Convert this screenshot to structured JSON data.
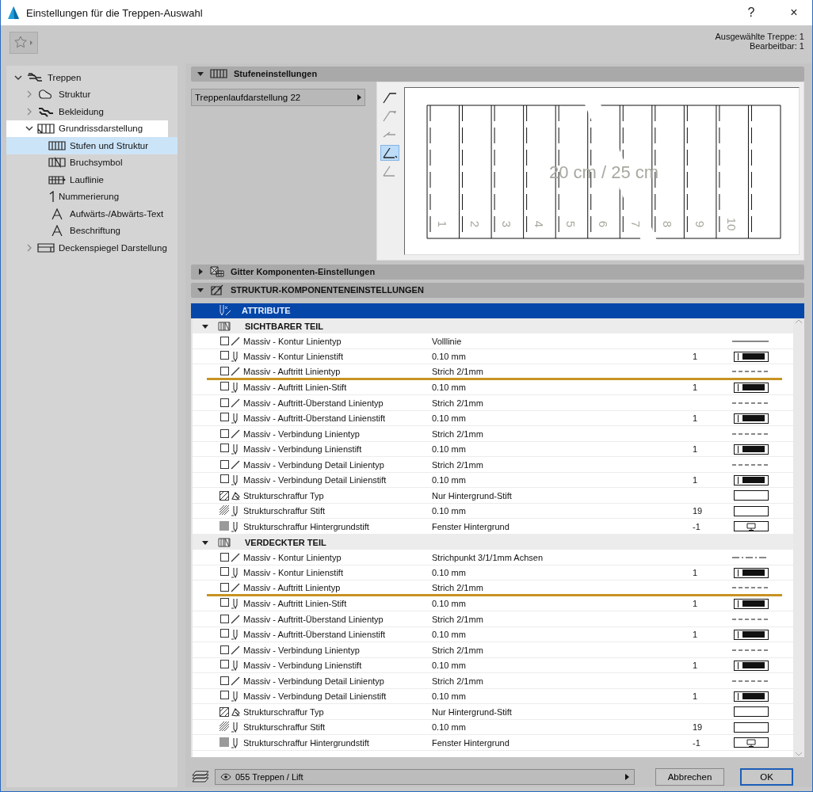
{
  "window": {
    "title": "Einstellungen für die Treppen-Auswahl",
    "help": "?",
    "close": "×"
  },
  "info": [
    "Ausgewählte Treppe: 1",
    "Bearbeitbar: 1"
  ],
  "tree": [
    {
      "label": "Treppen",
      "expanded": true,
      "selected": false,
      "highlighted": false,
      "children": [
        {
          "label": "Struktur",
          "expanded": false,
          "selected": false,
          "highlighted": false
        },
        {
          "label": "Bekleidung",
          "expanded": false,
          "selected": false,
          "highlighted": false
        },
        {
          "label": "Grundrissdarstellung",
          "expanded": true,
          "selected": false,
          "highlighted": true,
          "children": [
            {
              "label": "Stufen und Struktur",
              "selected": true,
              "highlighted": true
            },
            {
              "label": "Bruchsymbol",
              "selected": false,
              "highlighted": false
            },
            {
              "label": "Lauflinie",
              "selected": false,
              "highlighted": false
            },
            {
              "label": "Nummerierung",
              "selected": false,
              "highlighted": false
            },
            {
              "label": "Aufwärts-/Abwärts-Text",
              "selected": false,
              "highlighted": false
            },
            {
              "label": "Beschriftung",
              "selected": false,
              "highlighted": false
            }
          ]
        },
        {
          "label": "Deckenspiegel Darstellung",
          "expanded": false,
          "selected": false,
          "highlighted": false
        }
      ]
    }
  ],
  "step_settings": {
    "title": "Stufeneinstellungen",
    "expanded": true,
    "dropdown": "Treppenlaufdarstellung 22",
    "tools": [
      {
        "selected": false
      },
      {
        "selected": false
      },
      {
        "selected": false
      },
      {
        "selected": true
      },
      {
        "selected": false
      }
    ],
    "preview": {
      "dimension_label": "20 cm / 25 cm",
      "step_numbers": [
        "1",
        "2",
        "3",
        "4",
        "5",
        "6",
        "7",
        "8",
        "9",
        "10"
      ]
    }
  },
  "grid_settings": {
    "title": "Gitter Komponenten-Einstellungen",
    "expanded": false
  },
  "structure_settings": {
    "title": "STRUKTUR-KOMPONENTENEINSTELLUNGEN",
    "expanded": true,
    "attribute_header": "ATTRIBUTE",
    "sections": [
      {
        "title": "SICHTBARER TEIL",
        "expanded": true,
        "rows": [
          {
            "kind": "linetype",
            "checked": false,
            "name": "Massiv - Kontur Linientyp",
            "value": "Volllinie",
            "sample": {
              "kind": "solid"
            },
            "highlighted": false
          },
          {
            "kind": "pen",
            "checked": false,
            "name": "Massiv - Kontur Linienstift",
            "value": "0.10 mm",
            "number": "1",
            "sample": {
              "kind": "pen"
            },
            "highlighted": false
          },
          {
            "kind": "linetype",
            "checked": false,
            "name": "Massiv - Auftritt Linientyp",
            "value": "Strich 2/1mm",
            "sample": {
              "kind": "dashed"
            },
            "highlighted": true
          },
          {
            "kind": "pen",
            "checked": false,
            "name": "Massiv - Auftritt Linien-Stift",
            "value": "0.10 mm",
            "number": "1",
            "sample": {
              "kind": "pen"
            },
            "highlighted": false
          },
          {
            "kind": "linetype",
            "checked": false,
            "name": "Massiv - Auftritt-Überstand Linientyp",
            "value": "Strich 2/1mm",
            "sample": {
              "kind": "dashed"
            },
            "highlighted": false
          },
          {
            "kind": "pen",
            "checked": false,
            "name": "Massiv - Auftritt-Überstand Linienstift",
            "value": "0.10 mm",
            "number": "1",
            "sample": {
              "kind": "pen"
            },
            "highlighted": false
          },
          {
            "kind": "linetype",
            "checked": false,
            "name": "Massiv - Verbindung Linientyp",
            "value": "Strich 2/1mm",
            "sample": {
              "kind": "dashed"
            },
            "highlighted": false
          },
          {
            "kind": "pen",
            "checked": false,
            "name": "Massiv - Verbindung Linienstift",
            "value": "0.10 mm",
            "number": "1",
            "sample": {
              "kind": "pen"
            },
            "highlighted": false
          },
          {
            "kind": "linetype",
            "checked": false,
            "name": "Massiv - Verbindung Detail Linientyp",
            "value": "Strich 2/1mm",
            "sample": {
              "kind": "dashed"
            },
            "highlighted": false
          },
          {
            "kind": "pen",
            "checked": false,
            "name": "Massiv - Verbindung Detail Linienstift",
            "value": "0.10 mm",
            "number": "1",
            "sample": {
              "kind": "pen"
            },
            "highlighted": false
          },
          {
            "kind": "fill-type",
            "name": "Strukturschraffur Typ",
            "value": "Nur Hintergrund-Stift",
            "sample": {
              "kind": "blank"
            },
            "highlighted": false
          },
          {
            "kind": "fill-pen",
            "name": "Strukturschraffur Stift",
            "value": "0.10 mm",
            "number": "19",
            "sample": {
              "kind": "blank"
            },
            "highlighted": false
          },
          {
            "kind": "background-pen",
            "name": "Strukturschraffur Hintergrundstift",
            "value": "Fenster Hintergrund",
            "number": "-1",
            "sample": {
              "kind": "screen"
            },
            "highlighted": false
          }
        ]
      },
      {
        "title": "VERDECKTER TEIL",
        "expanded": true,
        "rows": [
          {
            "kind": "linetype",
            "checked": false,
            "name": "Massiv - Kontur Linientyp",
            "value": "Strichpunkt 3/1/1mm Achsen",
            "sample": {
              "kind": "dashdot"
            },
            "highlighted": false
          },
          {
            "kind": "pen",
            "checked": false,
            "name": "Massiv - Kontur Linienstift",
            "value": "0.10 mm",
            "number": "1",
            "sample": {
              "kind": "pen"
            },
            "highlighted": false
          },
          {
            "kind": "linetype",
            "checked": false,
            "name": "Massiv - Auftritt Linientyp",
            "value": "Strich 2/1mm",
            "sample": {
              "kind": "dashed"
            },
            "highlighted": true
          },
          {
            "kind": "pen",
            "checked": false,
            "name": "Massiv - Auftritt Linien-Stift",
            "value": "0.10 mm",
            "number": "1",
            "sample": {
              "kind": "pen"
            },
            "highlighted": false
          },
          {
            "kind": "linetype",
            "checked": false,
            "name": "Massiv - Auftritt-Überstand Linientyp",
            "value": "Strich 2/1mm",
            "sample": {
              "kind": "dashed"
            },
            "highlighted": false
          },
          {
            "kind": "pen",
            "checked": false,
            "name": "Massiv - Auftritt-Überstand Linienstift",
            "value": "0.10 mm",
            "number": "1",
            "sample": {
              "kind": "pen"
            },
            "highlighted": false
          },
          {
            "kind": "linetype",
            "checked": false,
            "name": "Massiv - Verbindung Linientyp",
            "value": "Strich 2/1mm",
            "sample": {
              "kind": "dashed"
            },
            "highlighted": false
          },
          {
            "kind": "pen",
            "checked": false,
            "name": "Massiv - Verbindung Linienstift",
            "value": "0.10 mm",
            "number": "1",
            "sample": {
              "kind": "pen"
            },
            "highlighted": false
          },
          {
            "kind": "linetype",
            "checked": false,
            "name": "Massiv - Verbindung Detail Linientyp",
            "value": "Strich 2/1mm",
            "sample": {
              "kind": "dashed"
            },
            "highlighted": false
          },
          {
            "kind": "pen",
            "checked": false,
            "name": "Massiv - Verbindung Detail Linienstift",
            "value": "0.10 mm",
            "number": "1",
            "sample": {
              "kind": "pen"
            },
            "highlighted": false
          },
          {
            "kind": "fill-type",
            "name": "Strukturschraffur Typ",
            "value": "Nur Hintergrund-Stift",
            "sample": {
              "kind": "blank"
            },
            "highlighted": false
          },
          {
            "kind": "fill-pen",
            "name": "Strukturschraffur Stift",
            "value": "0.10 mm",
            "number": "19",
            "sample": {
              "kind": "blank"
            },
            "highlighted": false
          },
          {
            "kind": "background-pen",
            "name": "Strukturschraffur Hintergrundstift",
            "value": "Fenster Hintergrund",
            "number": "-1",
            "sample": {
              "kind": "screen"
            },
            "highlighted": false
          }
        ]
      }
    ]
  },
  "footer": {
    "layer": "055 Treppen / Lift",
    "buttons": [
      {
        "label": "Abbrechen",
        "default": false
      },
      {
        "label": "OK",
        "default": true
      }
    ]
  }
}
